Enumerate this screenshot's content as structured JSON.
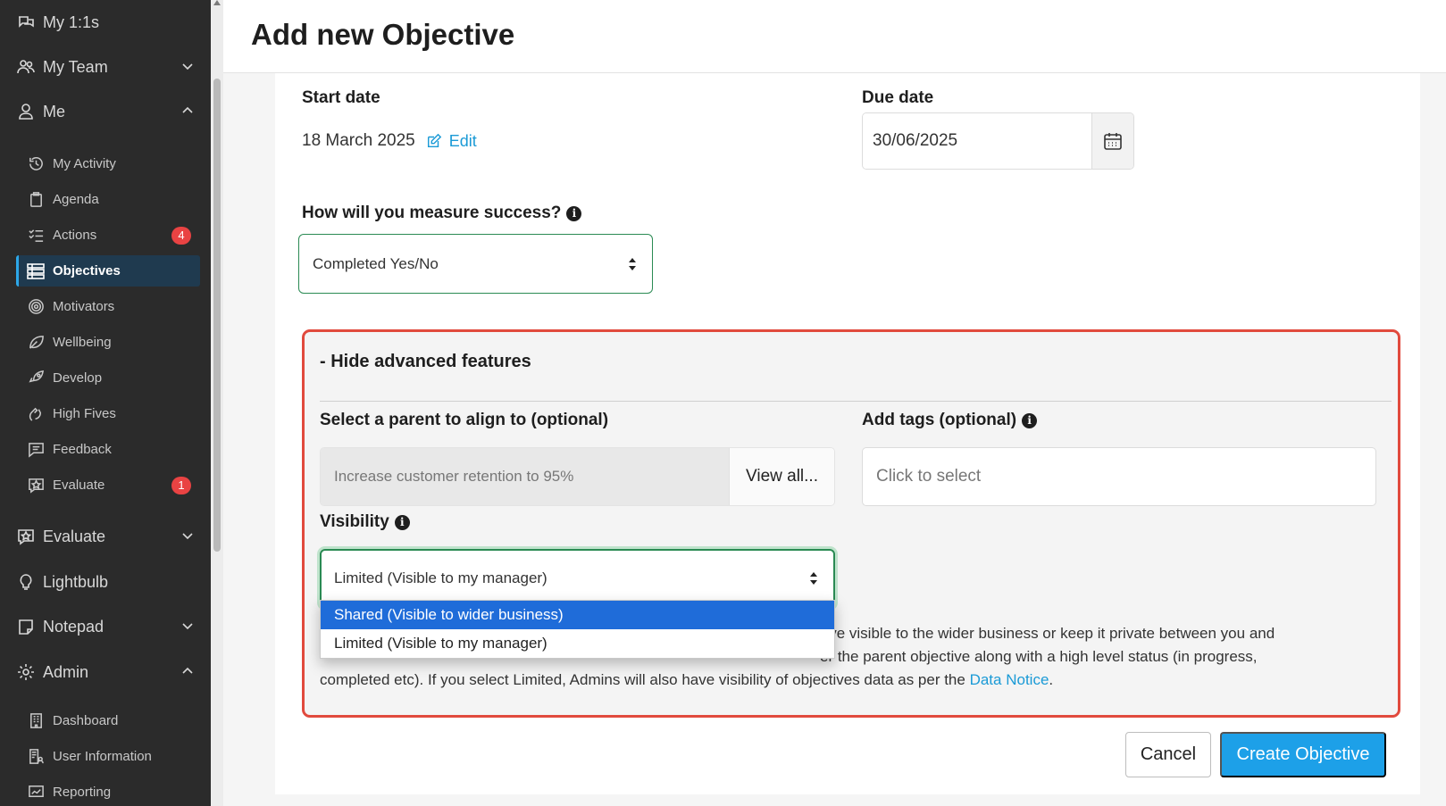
{
  "sidebar": {
    "top_items": [
      {
        "label": "My 1:1s",
        "icon": "chat-bubbles-icon"
      },
      {
        "label": "My Team",
        "icon": "team-icon"
      },
      {
        "label": "Me",
        "icon": "user-icon"
      }
    ],
    "me_items": [
      {
        "label": "My Activity",
        "icon": "history-icon"
      },
      {
        "label": "Agenda",
        "icon": "clipboard-icon"
      },
      {
        "label": "Actions",
        "icon": "checklist-icon",
        "badge": "4"
      },
      {
        "label": "Objectives",
        "icon": "objectives-icon",
        "active": true
      },
      {
        "label": "Motivators",
        "icon": "target-icon"
      },
      {
        "label": "Wellbeing",
        "icon": "leaf-icon"
      },
      {
        "label": "Develop",
        "icon": "rocket-icon"
      },
      {
        "label": "High Fives",
        "icon": "high-five-icon"
      },
      {
        "label": "Feedback",
        "icon": "feedback-icon"
      },
      {
        "label": "Evaluate",
        "icon": "evaluate-star-icon",
        "badge": "1"
      }
    ],
    "mid_items": [
      {
        "label": "Evaluate",
        "icon": "evaluate-star-icon"
      },
      {
        "label": "Lightbulb",
        "icon": "lightbulb-icon"
      },
      {
        "label": "Notepad",
        "icon": "notepad-icon"
      },
      {
        "label": "Admin",
        "icon": "gear-icon"
      }
    ],
    "admin_items": [
      {
        "label": "Dashboard",
        "icon": "building-icon"
      },
      {
        "label": "User Information",
        "icon": "user-info-icon"
      },
      {
        "label": "Reporting",
        "icon": "reporting-icon"
      }
    ],
    "colors": {
      "background": "#2b2b2b",
      "active": "#1f3a4f",
      "badge": "#e94343"
    }
  },
  "header": {
    "title": "Add new Objective"
  },
  "form": {
    "start_date": {
      "label": "Start date",
      "value": "18 March 2025",
      "edit_label": "Edit"
    },
    "due_date": {
      "label": "Due date",
      "value": "30/06/2025"
    },
    "measure": {
      "label": "How will you measure success?",
      "value": "Completed Yes/No"
    },
    "advanced": {
      "toggle_label": "- Hide advanced features",
      "parent": {
        "label": "Select a parent to align to (optional)",
        "value": "Increase customer retention to 95%",
        "view_all": "View all..."
      },
      "tags": {
        "label": "Add tags (optional)",
        "placeholder": "Click to select"
      },
      "visibility": {
        "label": "Visibility",
        "value": "Limited (Visible to my manager)",
        "options": [
          "Shared (Visible to wider business)",
          "Limited (Visible to my manager)"
        ],
        "help_text_1": "jective visible to the wider business or keep it private between you and",
        "help_text_2": "er the parent objective along with a high level status (in progress,",
        "help_text_3": "completed etc). If you select Limited, Admins will also have visibility of objectives data as per the ",
        "help_link": "Data Notice",
        "help_end": "."
      }
    },
    "cancel_label": "Cancel",
    "create_label": "Create Objective"
  },
  "colors": {
    "primary": "#1da0e8",
    "highlight_border": "#e14a3d",
    "focus": "#2a8a53",
    "dropdown_selected": "#1f6cd9"
  }
}
